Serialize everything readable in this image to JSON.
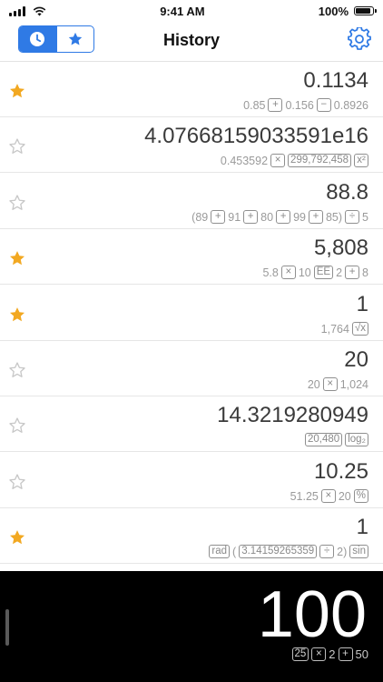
{
  "status_bar": {
    "time": "9:41 AM",
    "battery": "100%",
    "battery_level": 1.0
  },
  "nav": {
    "title": "History",
    "segments": [
      {
        "icon": "clock-icon",
        "selected": true
      },
      {
        "icon": "star-icon",
        "selected": false
      }
    ],
    "settings_icon": "gear-icon",
    "accent_color": "#2f7ae5"
  },
  "history": [
    {
      "favorite": true,
      "result": "0.1134",
      "tokens": [
        {
          "t": "0.85"
        },
        {
          "t": "+",
          "box": true
        },
        {
          "t": "0.156"
        },
        {
          "t": "−",
          "box": true
        },
        {
          "t": "0.8926"
        }
      ]
    },
    {
      "favorite": false,
      "result": "4.07668159033591e16",
      "tokens": [
        {
          "t": "0.453592"
        },
        {
          "t": "×",
          "box": true
        },
        {
          "t": "299,792,458",
          "box": true
        },
        {
          "t": "x²",
          "box": true
        }
      ]
    },
    {
      "favorite": false,
      "result": "88.8",
      "tokens": [
        {
          "t": "(89"
        },
        {
          "t": "+",
          "box": true
        },
        {
          "t": "91"
        },
        {
          "t": "+",
          "box": true
        },
        {
          "t": "80"
        },
        {
          "t": "+",
          "box": true
        },
        {
          "t": "99"
        },
        {
          "t": "+",
          "box": true
        },
        {
          "t": "85)"
        },
        {
          "t": "÷",
          "box": true
        },
        {
          "t": "5"
        }
      ]
    },
    {
      "favorite": true,
      "result": "5,808",
      "tokens": [
        {
          "t": "5.8"
        },
        {
          "t": "×",
          "box": true
        },
        {
          "t": "10"
        },
        {
          "t": "EE",
          "box": true
        },
        {
          "t": "2"
        },
        {
          "t": "+",
          "box": true
        },
        {
          "t": "8"
        }
      ]
    },
    {
      "favorite": true,
      "result": "1",
      "tokens": [
        {
          "t": "1,764"
        },
        {
          "t": "√x",
          "box": true
        }
      ]
    },
    {
      "favorite": false,
      "result": "20",
      "tokens": [
        {
          "t": "20"
        },
        {
          "t": "×",
          "box": true
        },
        {
          "t": "1,024"
        }
      ]
    },
    {
      "favorite": false,
      "result": "14.3219280949",
      "tokens": [
        {
          "t": "20,480",
          "box": true
        },
        {
          "t": "log₂",
          "box": true
        }
      ]
    },
    {
      "favorite": false,
      "result": "10.25",
      "tokens": [
        {
          "t": "51.25"
        },
        {
          "t": "×",
          "box": true
        },
        {
          "t": "20"
        },
        {
          "t": "%",
          "box": true
        }
      ]
    },
    {
      "favorite": true,
      "result": "1",
      "tokens": [
        {
          "t": "rad",
          "box": true
        },
        {
          "t": "("
        },
        {
          "t": "3.14159265359",
          "box": true
        },
        {
          "t": "÷",
          "box": true
        },
        {
          "t": "2)"
        },
        {
          "t": "sin",
          "box": true
        }
      ]
    }
  ],
  "display": {
    "value": "100",
    "tokens": [
      {
        "t": "25",
        "box": true
      },
      {
        "t": "×",
        "box": true
      },
      {
        "t": "2"
      },
      {
        "t": "+",
        "box": true
      },
      {
        "t": "50"
      }
    ]
  },
  "colors": {
    "star_filled": "#f2a821",
    "star_empty": "#c8c8c8"
  }
}
